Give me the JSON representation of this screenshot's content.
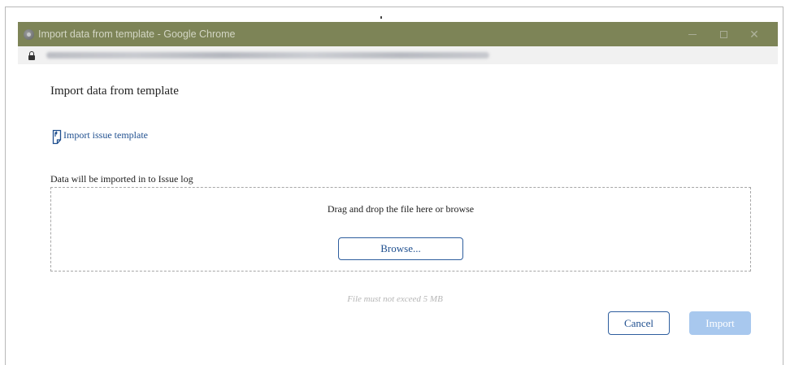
{
  "window": {
    "title": "Import data from template - Google Chrome",
    "controls": {
      "minimize": "—",
      "close": "✕"
    }
  },
  "dialog": {
    "title": "Import data from template",
    "template_link": "Import issue template",
    "import_target": "Data will be imported in to Issue log",
    "dropzone_text": "Drag and drop the file here or browse",
    "browse_label": "Browse...",
    "size_note": "File must not exceed 5 MB",
    "cancel_label": "Cancel",
    "import_label": "Import"
  },
  "colors": {
    "titlebar": "#7d8457",
    "link": "#1f4f8f",
    "import_disabled": "#a8c8ee"
  },
  "icons": [
    "chrome-icon",
    "lock-icon",
    "document-import-icon"
  ]
}
